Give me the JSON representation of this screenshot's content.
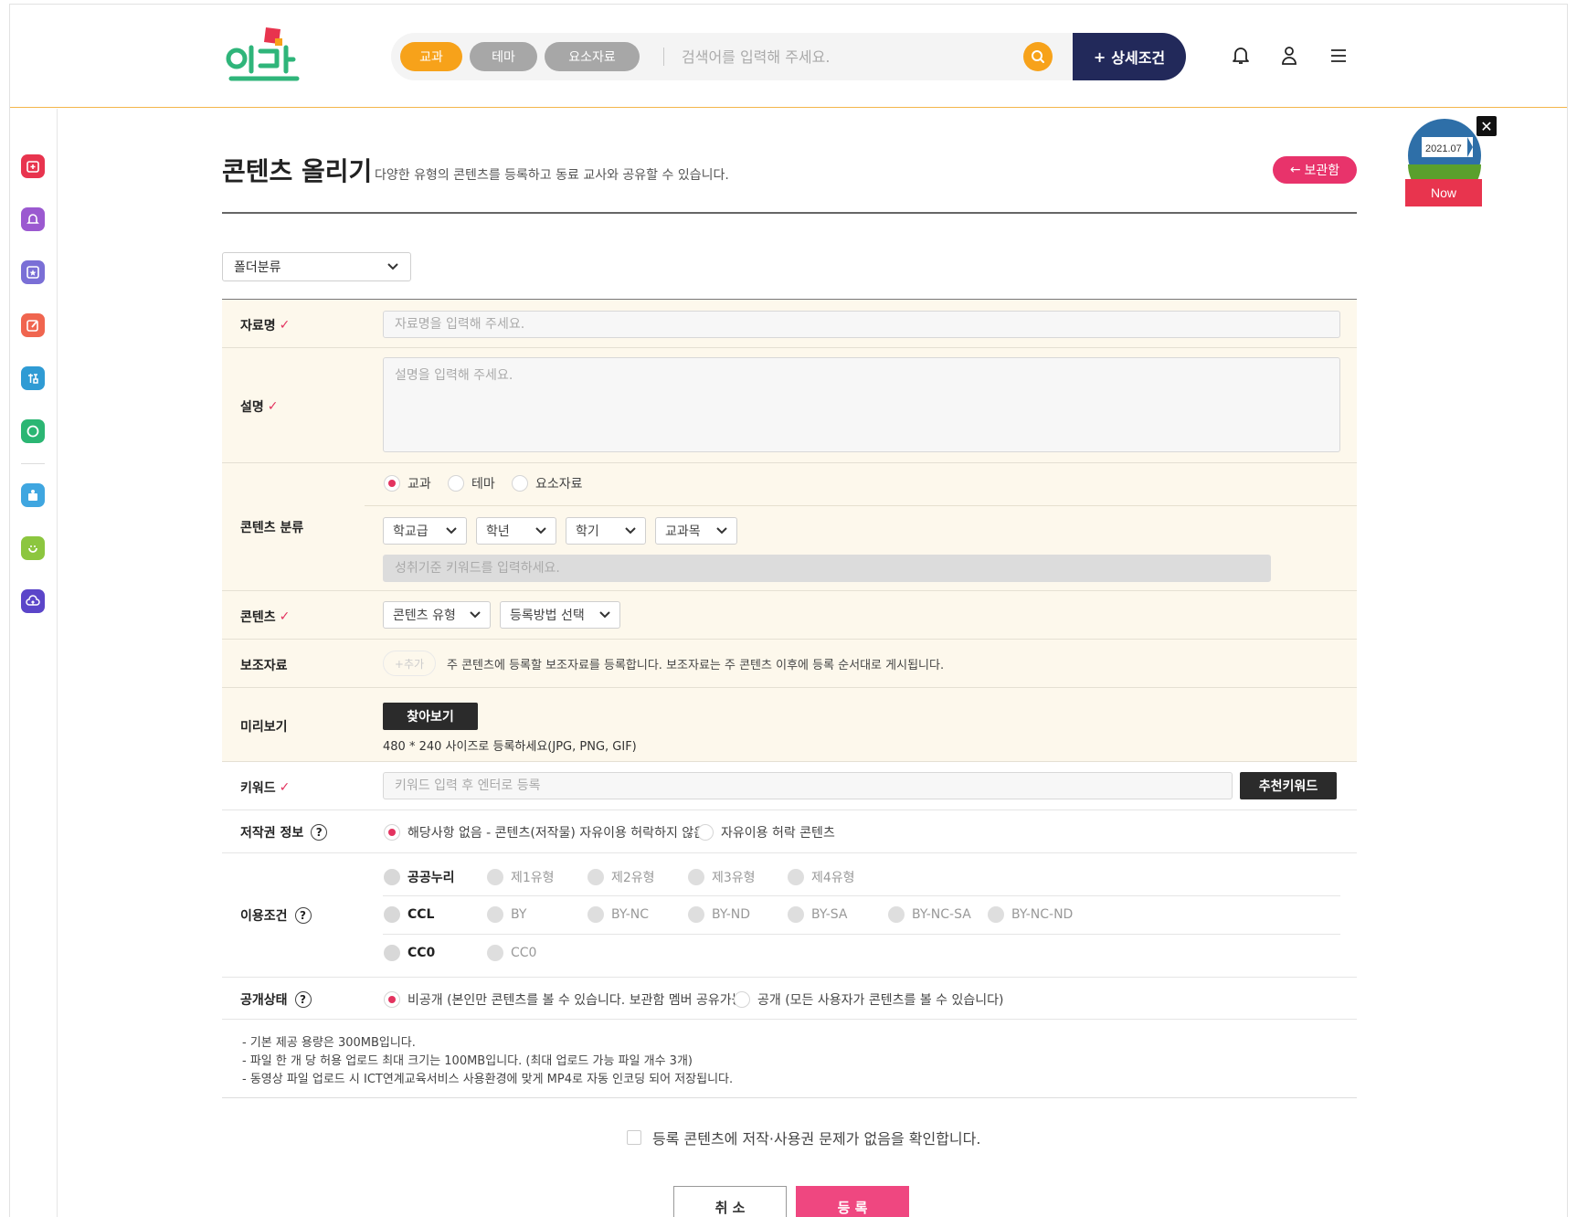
{
  "header": {
    "logo_text": "잇다",
    "tabs": [
      {
        "label": "교과",
        "active": true
      },
      {
        "label": "테마",
        "active": false
      },
      {
        "label": "요소자료",
        "active": false
      }
    ],
    "search_placeholder": "검색어를 입력해 주세요.",
    "detail_button": "상세조건",
    "detail_icon": "+",
    "icons": [
      "bell-icon",
      "user-icon",
      "menu-icon"
    ]
  },
  "sidebar": {
    "items": [
      {
        "icon": "add-box-icon",
        "color": "#e8344e"
      },
      {
        "icon": "bell-icon",
        "color": "#9b59d0"
      },
      {
        "icon": "star-box-icon",
        "color": "#7a6fd6"
      },
      {
        "icon": "edit-icon",
        "color": "#f0654f"
      },
      {
        "icon": "study-icon",
        "color": "#2f9bd4"
      },
      {
        "icon": "chat-icon",
        "color": "#2bb673"
      },
      {
        "icon": "school-icon",
        "color": "#3fa6e0"
      },
      {
        "icon": "smile-icon",
        "color": "#8cc63f"
      },
      {
        "icon": "cloud-upload-icon",
        "color": "#5b45c9"
      }
    ]
  },
  "badge": {
    "date": "2021.07",
    "label": "Now",
    "close": "✕"
  },
  "page": {
    "title": "콘텐츠 올리기",
    "description": "다양한 유형의 콘텐츠를 등록하고 동료 교사와 공유할 수 있습니다.",
    "locker_button": "보관함",
    "locker_arrow": "←",
    "folder_select": "폴더분류"
  },
  "form": {
    "title_label": "자료명",
    "title_placeholder": "자료명을 입력해 주세요.",
    "desc_label": "설명",
    "desc_placeholder": "설명을 입력해 주세요.",
    "category_label": "콘텐츠 분류",
    "category_options": [
      "교과",
      "테마",
      "요소자료"
    ],
    "category_selected": "교과",
    "school_level": "학교급",
    "grade": "학년",
    "semester": "학기",
    "subject": "교과목",
    "achievement_placeholder": "성취기준 키워드를 입력하세요.",
    "content_label": "콘텐츠",
    "content_type": "콘텐츠 유형",
    "register_method": "등록방법 선택",
    "supplement_label": "보조자료",
    "supplement_add": "+추가",
    "supplement_desc": "주 콘텐츠에 등록할 보조자료를 등록합니다. 보조자료는 주 콘텐츠 이후에 등록 순서대로 게시됩니다.",
    "preview_label": "미리보기",
    "preview_button": "찾아보기",
    "preview_hint": "480 * 240 사이즈로 등록하세요(JPG, PNG, GIF)",
    "keyword_label": "키워드",
    "keyword_placeholder": "키워드 입력 후 엔터로 등록",
    "keyword_button": "추천키워드",
    "copyright_label": "저작권 정보",
    "copyright_opt1": "해당사항 없음 - 콘텐츠(저작물) 자유이용 허락하지 않음",
    "copyright_opt2": "자유이용 허락 콘텐츠",
    "terms_label": "이용조건",
    "terms_row1": [
      "공공누리",
      "제1유형",
      "제2유형",
      "제3유형",
      "제4유형"
    ],
    "terms_row2": [
      "CCL",
      "BY",
      "BY-NC",
      "BY-ND",
      "BY-SA",
      "BY-NC-SA",
      "BY-NC-ND"
    ],
    "terms_row3": [
      "CC0",
      "CC0"
    ],
    "visibility_label": "공개상태",
    "visibility_opt1": "비공개 (본인만 콘텐츠를 볼 수 있습니다. 보관함 멤버 공유가능)",
    "visibility_opt2": "공개 (모든 사용자가 콘텐츠를 볼 수 있습니다)",
    "check_mark": "✓",
    "help_mark": "?"
  },
  "notes": [
    "- 기본 제공 용량은 300MB입니다.",
    "- 파일 한 개 당 허용 업로드 최대 크기는 100MB입니다. (최대 업로드 가능 파일 개수 3개)",
    "- 동영상 파일 업로드 시 ICT연계교육서비스 사용환경에 맞게 MP4로 자동 인코딩 되어 저장됩니다."
  ],
  "confirm_text": "등록 콘텐츠에 저작·사용권 문제가 없음을 확인합니다.",
  "buttons": {
    "cancel": "취 소",
    "submit": "등 록"
  },
  "colors": {
    "accent": "#f7a21a",
    "navy": "#22295a",
    "pink": "#e8336b",
    "form_bg": "#fdf8ec"
  }
}
